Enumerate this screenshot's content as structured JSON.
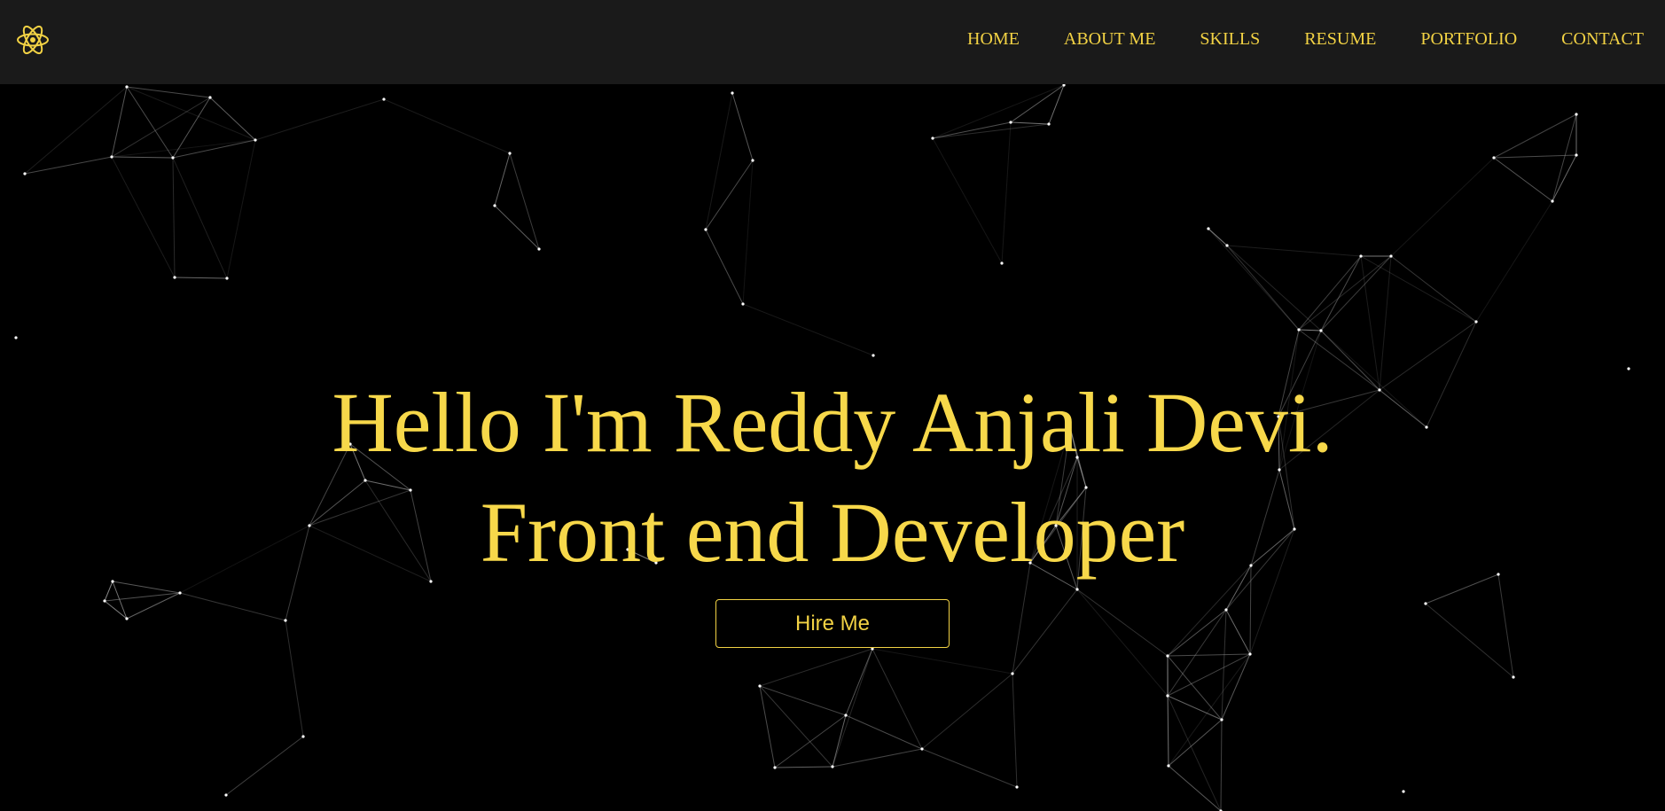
{
  "nav": {
    "logo_icon": "react-atom-icon",
    "items": [
      {
        "label": "HOME"
      },
      {
        "label": "ABOUT ME"
      },
      {
        "label": "SKILLS"
      },
      {
        "label": "RESUME"
      },
      {
        "label": "PORTFOLIO"
      },
      {
        "label": "CONTACT"
      }
    ]
  },
  "hero": {
    "greeting": "Hello I'm Reddy Anjali Devi.",
    "role": "Front end Developer",
    "cta_label": "Hire Me"
  },
  "colors": {
    "accent": "#f2d244",
    "navbar_background": "#1a1a1a",
    "page_background": "#000000",
    "network_lines": "#9a9a9a"
  },
  "background": {
    "type": "particle-network"
  }
}
